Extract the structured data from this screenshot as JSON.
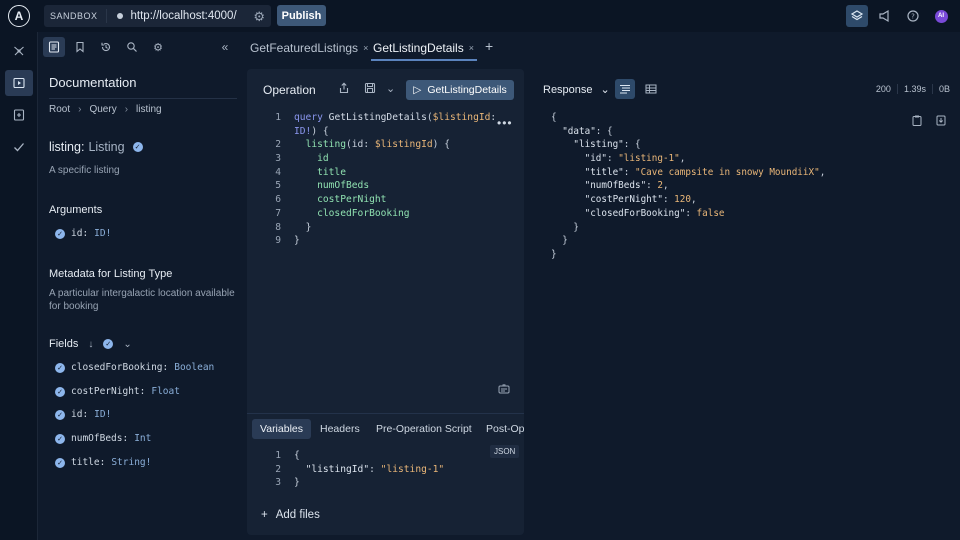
{
  "topbar": {
    "logo": "A",
    "sandbox_label": "SANDBOX",
    "url": "http://localhost:4000/",
    "publish_label": "Publish",
    "icons": [
      "schema-icon",
      "megaphone-icon",
      "help-icon",
      "avatar"
    ],
    "avatar_initials": "AI"
  },
  "rail": {
    "icons": [
      "graph-icon",
      "explorer-icon",
      "saved-icon",
      "checks-icon"
    ],
    "collapse": "»"
  },
  "docs": {
    "title": "Documentation",
    "breadcrumbs": [
      "Root",
      "Query",
      "listing"
    ],
    "field_name": "listing:",
    "field_type": "Listing",
    "field_description": "A specific listing",
    "arguments_title": "Arguments",
    "arguments": [
      {
        "name": "id:",
        "type": "ID!"
      }
    ],
    "metadata_title": "Metadata for Listing Type",
    "metadata_description": "A particular intergalactic location available for booking",
    "fields_title": "Fields",
    "fields": [
      {
        "name": "closedForBooking:",
        "type": "Boolean"
      },
      {
        "name": "costPerNight:",
        "type": "Float"
      },
      {
        "name": "id:",
        "type": "ID!"
      },
      {
        "name": "numOfBeds:",
        "type": "Int"
      },
      {
        "name": "title:",
        "type": "String!"
      }
    ]
  },
  "tabs": [
    {
      "label": "GetFeaturedListings",
      "close": "×"
    },
    {
      "label": "GetListingDetails",
      "close": "×"
    }
  ],
  "tab_add": "+",
  "operation": {
    "title": "Operation",
    "run_label": "GetListingDetails",
    "variables_tabs": [
      "Variables",
      "Headers",
      "Pre-Operation Script",
      "Post-Operation Script"
    ],
    "json_badge": "JSON",
    "add_files": "Add files"
  },
  "response": {
    "title": "Response",
    "status": "200",
    "time": "1.39s",
    "size": "0B"
  }
}
